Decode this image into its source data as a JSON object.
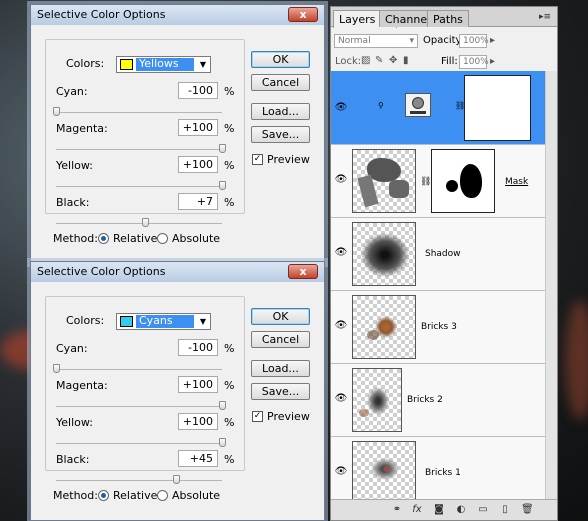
{
  "dialogs": [
    {
      "title": "Selective Color Options",
      "close_label": "x",
      "colors_label": "Colors:",
      "colors_value": "Yellows",
      "colors_swatch": "#ffff00",
      "sliders": [
        {
          "label": "Cyan:",
          "value": "-100",
          "unit": "%",
          "level": 0.0
        },
        {
          "label": "Magenta:",
          "value": "+100",
          "unit": "%",
          "level": 1.0
        },
        {
          "label": "Yellow:",
          "value": "+100",
          "unit": "%",
          "level": 1.0
        },
        {
          "label": "Black:",
          "value": "+7",
          "unit": "%",
          "level": 0.535
        }
      ],
      "buttons": {
        "ok": "OK",
        "cancel": "Cancel",
        "load": "Load...",
        "save": "Save..."
      },
      "preview_label": "Preview",
      "preview_checked": true,
      "method_label": "Method:",
      "method_options": [
        "Relative",
        "Absolute"
      ],
      "method_selected": "Relative"
    },
    {
      "title": "Selective Color Options",
      "close_label": "x",
      "colors_label": "Colors:",
      "colors_value": "Cyans",
      "colors_swatch": "#33ccee",
      "sliders": [
        {
          "label": "Cyan:",
          "value": "-100",
          "unit": "%",
          "level": 0.0
        },
        {
          "label": "Magenta:",
          "value": "+100",
          "unit": "%",
          "level": 1.0
        },
        {
          "label": "Yellow:",
          "value": "+100",
          "unit": "%",
          "level": 1.0
        },
        {
          "label": "Black:",
          "value": "+45",
          "unit": "%",
          "level": 0.725
        }
      ],
      "buttons": {
        "ok": "OK",
        "cancel": "Cancel",
        "load": "Load...",
        "save": "Save..."
      },
      "preview_label": "Preview",
      "preview_checked": true,
      "method_label": "Method:",
      "method_options": [
        "Relative",
        "Absolute"
      ],
      "method_selected": "Relative"
    }
  ],
  "layers_panel": {
    "tabs": [
      "Layers",
      "Channels",
      "Paths"
    ],
    "tab_close": "×",
    "active_tab": "Layers",
    "blend_mode": "Normal",
    "opacity_label": "Opacity:",
    "opacity_value": "100%",
    "lock_label": "Lock:",
    "fill_label": "Fill:",
    "fill_value": "100%",
    "layers": [
      {
        "name": "",
        "type": "adjustment",
        "selected": true
      },
      {
        "name": "Mask",
        "type": "masked"
      },
      {
        "name": "Shadow",
        "type": "normal"
      },
      {
        "name": "Bricks 3",
        "type": "normal"
      },
      {
        "name": "Bricks 2",
        "type": "normal"
      },
      {
        "name": "Bricks 1",
        "type": "normal"
      }
    ],
    "footer_icons": [
      "link-icon",
      "fx-icon",
      "mask-icon",
      "adjustment-icon",
      "folder-icon",
      "new-layer-icon",
      "trash-icon"
    ]
  },
  "colors": {
    "selection": "#3d8ff2",
    "dialog_bg": "#f0f0f0",
    "title_bar": "#c9d9ec"
  }
}
